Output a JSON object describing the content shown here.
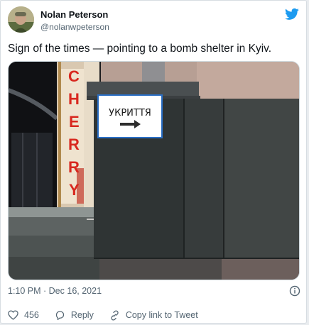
{
  "author": {
    "name": "Nolan Peterson",
    "handle": "@nolanwpeterson",
    "avatar_icon": "avatar-photo"
  },
  "brand": {
    "icon": "twitter-bird-icon",
    "color": "#1d9bf0"
  },
  "tweet": {
    "text": "Sign of the times — pointing to a bomb shelter in Kyiv.",
    "timestamp": "1:10 PM · Dec 16, 2021"
  },
  "photo": {
    "sign_text": "УКРИТТЯ",
    "storefront_text": "CHERRY"
  },
  "actions": {
    "like_count": "456",
    "reply_label": "Reply",
    "copy_link_label": "Copy link to Tweet"
  },
  "icons": {
    "info": "info-icon",
    "like": "heart-icon",
    "reply": "reply-icon",
    "link": "link-icon"
  }
}
